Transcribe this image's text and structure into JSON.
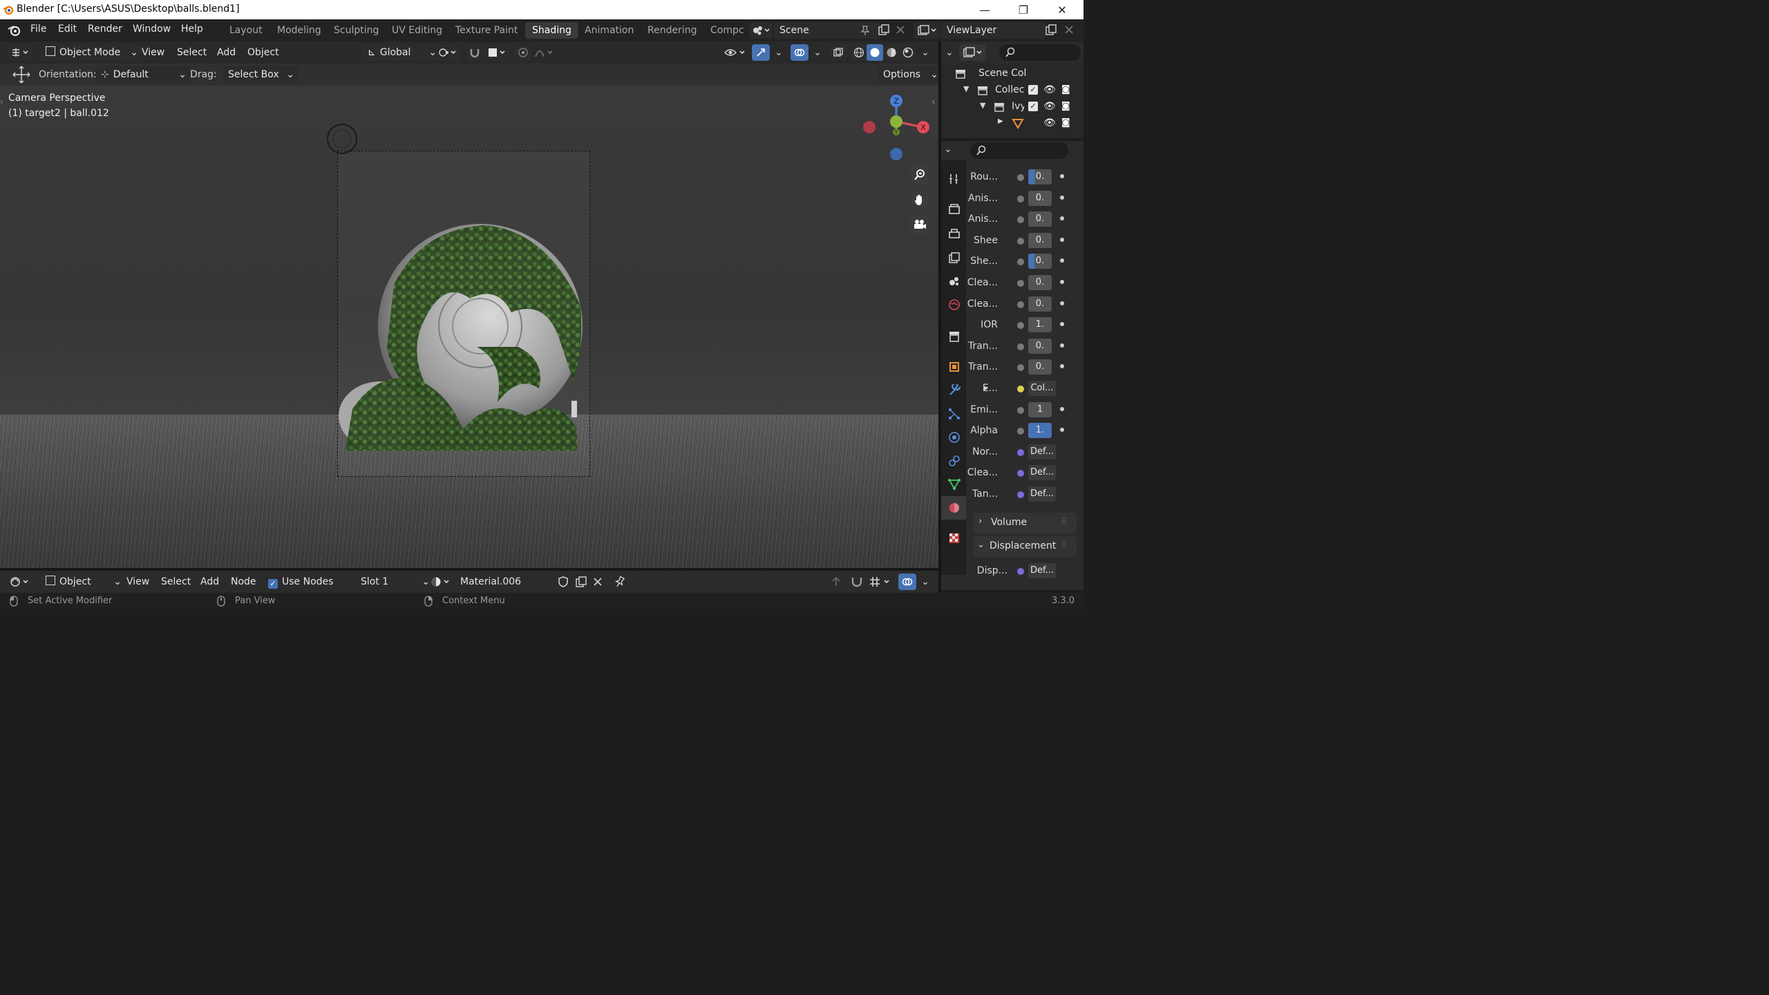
{
  "window": {
    "title": "Blender [C:\\Users\\ASUS\\Desktop\\balls.blend1]",
    "minimize": "—",
    "maximize": "❐",
    "close": "✕"
  },
  "menu": {
    "file": "File",
    "edit": "Edit",
    "render": "Render",
    "window": "Window",
    "help": "Help"
  },
  "workspaces": [
    "Layout",
    "Modeling",
    "Sculpting",
    "UV Editing",
    "Texture Paint",
    "Shading",
    "Animation",
    "Rendering",
    "Compc"
  ],
  "scene": {
    "name": "Scene",
    "view_layer": "ViewLayer"
  },
  "viewport_header": {
    "mode": "Object Mode",
    "view": "View",
    "select": "Select",
    "add": "Add",
    "object": "Object",
    "transform_orientation": "Global",
    "orientation_label": "Orientation:",
    "orientation_value": "Default",
    "drag_label": "Drag:",
    "drag_value": "Select Box",
    "options": "Options"
  },
  "viewport": {
    "camera_label": "Camera Perspective",
    "object_label": "(1) target2 | ball.012",
    "gizmo": {
      "z": "Z",
      "x": "X",
      "y": "Y"
    }
  },
  "outliner": {
    "rows": [
      {
        "label": "Scene Col"
      },
      {
        "label": "Collec"
      },
      {
        "label": "Ivy"
      }
    ]
  },
  "properties": {
    "rows": [
      {
        "label": "Rou...",
        "value": "0.",
        "style": "half"
      },
      {
        "label": "Anis...",
        "value": "0.",
        "style": ""
      },
      {
        "label": "Anis...",
        "value": "0.",
        "style": ""
      },
      {
        "label": "Shee",
        "value": "0.",
        "style": ""
      },
      {
        "label": "She...",
        "value": "0.",
        "style": "half"
      },
      {
        "label": "Clea...",
        "value": "0.",
        "style": ""
      },
      {
        "label": "Clea...",
        "value": "0.",
        "style": ""
      },
      {
        "label": "IOR",
        "value": "1.",
        "style": ""
      },
      {
        "label": "Tran...",
        "value": "0.",
        "style": ""
      },
      {
        "label": "Tran...",
        "value": "0.",
        "style": ""
      },
      {
        "label": "E...",
        "value": "Col...",
        "style": "link-yellow"
      },
      {
        "label": "Emi...",
        "value": "1",
        "style": ""
      },
      {
        "label": "Alpha",
        "value": "1.",
        "style": "blue"
      },
      {
        "label": "Nor...",
        "value": "Def...",
        "style": "link-purple"
      },
      {
        "label": "Clea...",
        "value": "Def...",
        "style": "link-purple"
      },
      {
        "label": "Tan...",
        "value": "Def...",
        "style": "link-purple"
      }
    ],
    "volume": "Volume",
    "displacement": "Displacement",
    "disp_label": "Disp...",
    "disp_value": "Def..."
  },
  "node_header": {
    "editor": "Object",
    "view": "View",
    "select": "Select",
    "add": "Add",
    "node": "Node",
    "use_nodes": "Use Nodes",
    "slot": "Slot 1",
    "material": "Material.006"
  },
  "status": {
    "left": "Set Active Modifier",
    "middle": "Pan View",
    "right": "Context Menu",
    "version": "3.3.0"
  },
  "colors": {
    "accent": "#4772b3",
    "x_axis": "#e04b5a",
    "y_axis": "#8bb53a",
    "z_axis": "#4a7fd6"
  }
}
